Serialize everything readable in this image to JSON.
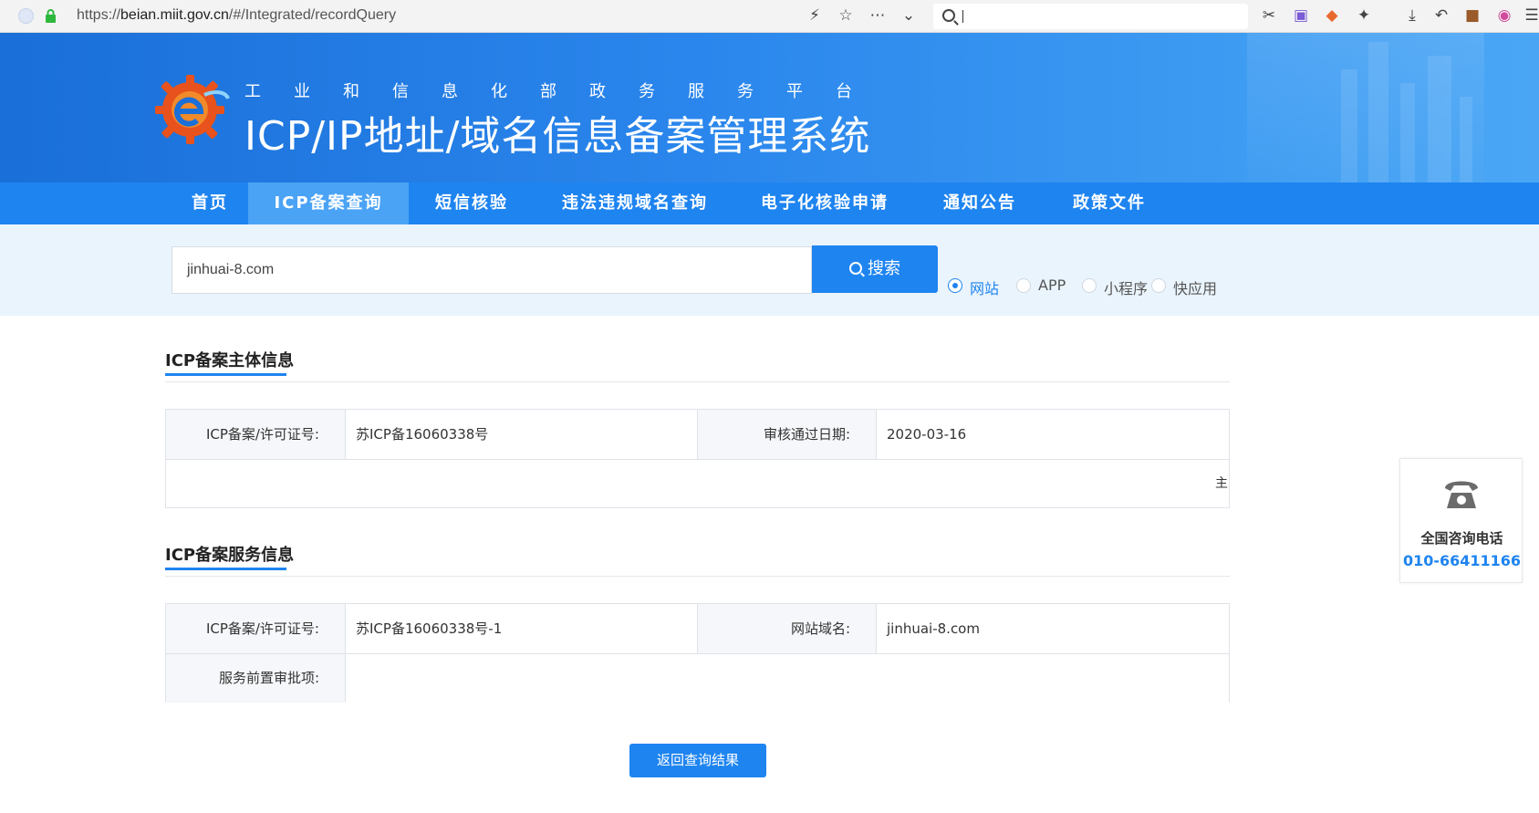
{
  "browser": {
    "url_prefix": "https://",
    "url_domain": "beian.miit.gov.cn",
    "url_path": "/#/Integrated/recordQuery"
  },
  "header": {
    "subtitle": "工业和信息化部政务服务平台",
    "title": "ICP/IP地址/域名信息备案管理系统"
  },
  "nav": {
    "items": [
      {
        "label": "首页",
        "active": false
      },
      {
        "label": "ICP备案查询",
        "active": true
      },
      {
        "label": "短信核验",
        "active": false
      },
      {
        "label": "违法违规域名查询",
        "active": false
      },
      {
        "label": "电子化核验申请",
        "active": false
      },
      {
        "label": "通知公告",
        "active": false
      },
      {
        "label": "政策文件",
        "active": false
      }
    ]
  },
  "search": {
    "value": "jinhuai-8.com",
    "button_label": "搜索",
    "options": [
      {
        "label": "网站",
        "selected": true
      },
      {
        "label": "APP",
        "selected": false
      },
      {
        "label": "小程序",
        "selected": false
      },
      {
        "label": "快应用",
        "selected": false
      }
    ]
  },
  "subject_section": {
    "title": "ICP备案主体信息",
    "license_label": "ICP备案/许可证号:",
    "license_value": "苏ICP备16060338号",
    "approve_date_label": "审核通过日期:",
    "approve_date_value": "2020-03-16",
    "overflow_char": "主"
  },
  "service_section": {
    "title": "ICP备案服务信息",
    "license_label": "ICP备案/许可证号:",
    "license_value": "苏ICP备16060338号-1",
    "domain_label": "网站域名:",
    "domain_value": "jinhuai-8.com",
    "preapproval_label": "服务前置审批项:",
    "preapproval_value": ""
  },
  "back_button": "返回查询结果",
  "contact": {
    "label": "全国咨询电话",
    "phone": "010-66411166"
  },
  "colors": {
    "primary": "#1e84f0",
    "nav_active": "#4aa3f5",
    "band": "#eaf4fd"
  }
}
